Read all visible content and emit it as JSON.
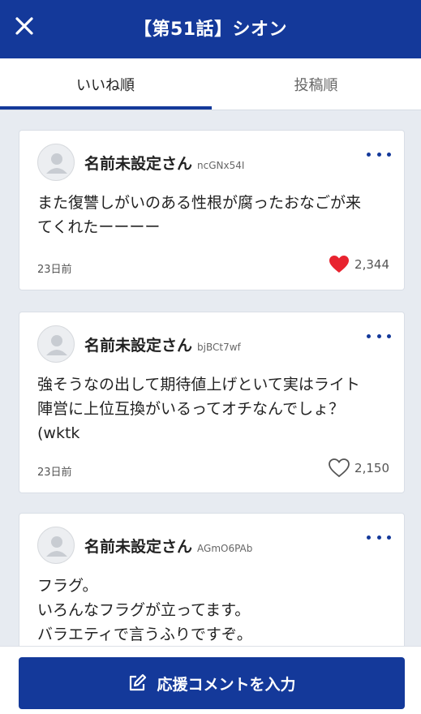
{
  "header": {
    "title": "【第51話】シオン",
    "close_icon": "close-icon"
  },
  "tabs": [
    {
      "label": "いいね順",
      "active": true
    },
    {
      "label": "投稿順",
      "active": false
    }
  ],
  "comments": [
    {
      "name": "名前未設定さん",
      "user_id": "ncGNx54I",
      "body": "また復讐しがいのある性根が腐ったおなごが来\nてくれたーーーー",
      "time": "23日前",
      "likes": "2,344",
      "liked": true
    },
    {
      "name": "名前未設定さん",
      "user_id": "bjBCt7wf",
      "body": "強そうなの出して期待値上げといて実はライト\n陣営に上位互換がいるってオチなんでしょ？\n(wktk",
      "time": "23日前",
      "likes": "2,150",
      "liked": false
    },
    {
      "name": "名前未設定さん",
      "user_id": "AGmO6PAb",
      "body": "フラグ。\nいろんなフラグが立ってます。\nバラエティで言うふりですぞ。",
      "time": "",
      "likes": "",
      "liked": false
    }
  ],
  "footer": {
    "cta_label": "応援コメントを入力",
    "cta_icon": "edit-icon"
  },
  "colors": {
    "brand": "#14399a",
    "like": "#e8232f",
    "background": "#e7ebf1"
  }
}
